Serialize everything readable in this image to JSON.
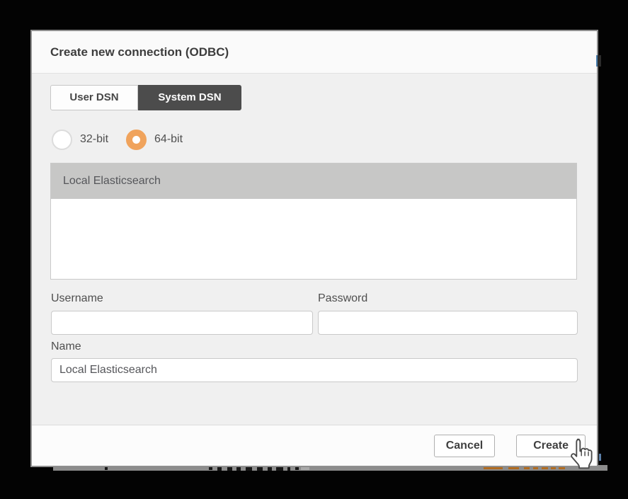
{
  "dialog": {
    "title": "Create new connection (ODBC)",
    "tabs": [
      {
        "label": "User DSN",
        "active": false
      },
      {
        "label": "System DSN",
        "active": true
      }
    ],
    "bitness_options": [
      {
        "label": "32-bit",
        "selected": false
      },
      {
        "label": "64-bit",
        "selected": true
      }
    ],
    "dsn_list": {
      "items": [
        {
          "label": "Local Elasticsearch",
          "selected": true
        }
      ]
    },
    "fields": {
      "username": {
        "label": "Username",
        "value": ""
      },
      "password": {
        "label": "Password",
        "value": ""
      },
      "name": {
        "label": "Name",
        "value": "Local Elasticsearch"
      }
    },
    "footer": {
      "cancel_label": "Cancel",
      "create_label": "Create"
    }
  },
  "colors": {
    "accent_orange": "#F0A35C",
    "active_tab_bg": "#4C4C4C",
    "selected_row_bg": "#C7C7C6",
    "dialog_body_bg": "#F0F0F0",
    "overlay": "#030303",
    "background_fragment_orange": "#B06A1F"
  }
}
